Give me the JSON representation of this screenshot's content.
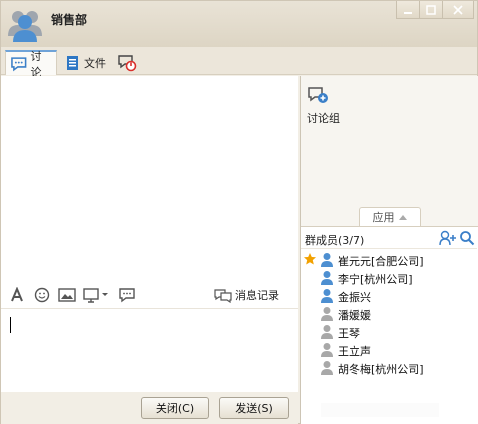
{
  "window": {
    "title": "销售部",
    "colors": {
      "chrome": "#ece6da",
      "accent": "#4d8fd1",
      "alert": "#d9302c",
      "star": "#f2a100"
    }
  },
  "tabs": [
    {
      "label": "讨论",
      "icon": "chat-bubble-icon",
      "active": true
    },
    {
      "label": "文件",
      "icon": "document-icon",
      "active": false
    },
    {
      "label": "",
      "icon": "power-icon",
      "active": false
    }
  ],
  "toolbar": {
    "items": [
      "font-icon",
      "emoji-icon",
      "image-icon",
      "screenshot-icon",
      "message-icon"
    ],
    "history_label": "消息记录"
  },
  "buttons": {
    "close": "关闭(C)",
    "send": "发送(S)"
  },
  "apps": {
    "discussion_label": "讨论组",
    "tab_label": "应用"
  },
  "members": {
    "title": "群成员(3/7)",
    "list": [
      {
        "name": "崔元元[合肥公司]",
        "starred": true,
        "online": true
      },
      {
        "name": "李宁[杭州公司]",
        "starred": false,
        "online": true
      },
      {
        "name": "金振兴",
        "starred": false,
        "online": true
      },
      {
        "name": "潘媛媛",
        "starred": false,
        "online": false
      },
      {
        "name": "王琴",
        "starred": false,
        "online": false
      },
      {
        "name": "王立声",
        "starred": false,
        "online": false
      },
      {
        "name": "胡冬梅[杭州公司]",
        "starred": false,
        "online": false
      }
    ]
  }
}
